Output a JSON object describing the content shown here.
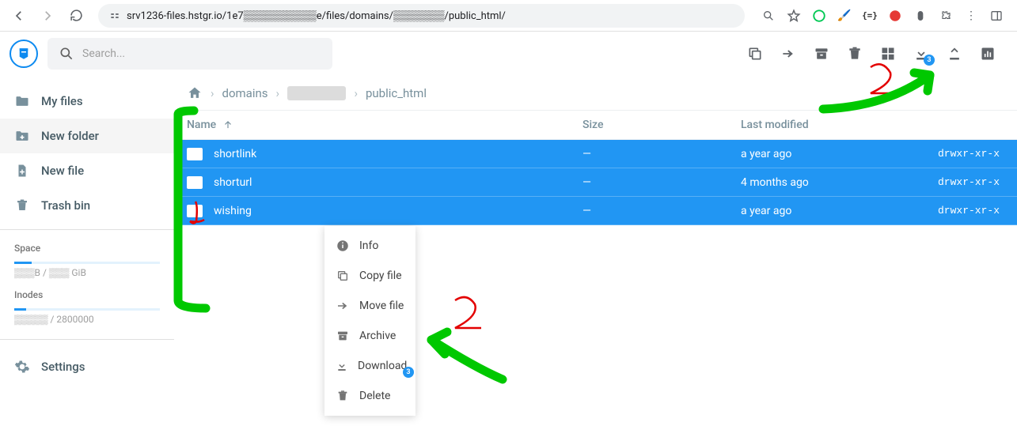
{
  "browser": {
    "url": "srv1236-files.hstgr.io/1e7▒▒▒▒▒▒▒▒▒▒e/files/domains/▒▒▒▒▒▒▒/public_html/"
  },
  "search": {
    "placeholder": "Search..."
  },
  "toolbar_badge": "3",
  "sidebar": {
    "items": [
      {
        "label": "My files"
      },
      {
        "label": "New folder"
      },
      {
        "label": "New file"
      },
      {
        "label": "Trash bin"
      }
    ],
    "space_label": "Space",
    "space_text": "▒▒▒B / ▒▒▒ GiB",
    "space_pct": 12,
    "inodes_label": "Inodes",
    "inodes_text": "▒▒▒▒▒ / 2800000",
    "inodes_pct": 8,
    "settings_label": "Settings"
  },
  "crumbs": [
    "domains",
    "▒▒▒▒▒▒▒",
    "public_html"
  ],
  "columns": {
    "name": "Name",
    "size": "Size",
    "modified": "Last modified"
  },
  "rows": [
    {
      "name": "shortlink",
      "size": "—",
      "modified": "a year ago",
      "perm": "drwxr-xr-x"
    },
    {
      "name": "shorturl",
      "size": "—",
      "modified": "4 months ago",
      "perm": "drwxr-xr-x"
    },
    {
      "name": "wishing",
      "size": "—",
      "modified": "a year ago",
      "perm": "drwxr-xr-x"
    }
  ],
  "context_menu": {
    "items": [
      {
        "label": "Info",
        "icon": "info"
      },
      {
        "label": "Copy file",
        "icon": "copy"
      },
      {
        "label": "Move file",
        "icon": "move"
      },
      {
        "label": "Archive",
        "icon": "archive"
      },
      {
        "label": "Download",
        "icon": "download",
        "badge": "3"
      },
      {
        "label": "Delete",
        "icon": "delete"
      }
    ]
  },
  "annotations": {
    "one": "1",
    "two_a": "2",
    "two_b": "2"
  }
}
